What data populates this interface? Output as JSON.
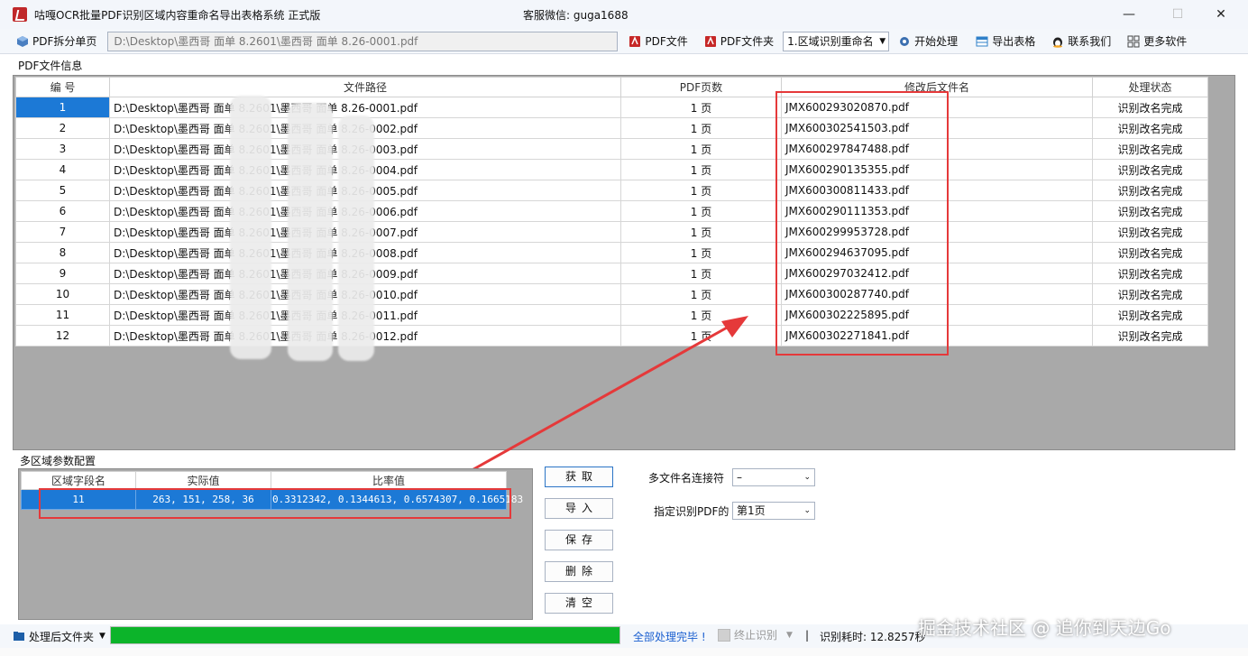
{
  "window": {
    "title": "咕嘎OCR批量PDF识别区域内容重命名导出表格系统    正式版",
    "service": "客服微信: guga1688",
    "minimize": "—",
    "maximize": "☐",
    "close": "✕"
  },
  "toolbar": {
    "split_label": "PDF拆分单页",
    "path_value": "D:\\Desktop\\墨西哥 面单 8.2601\\墨西哥 面单 8.26-0001.pdf",
    "pdf_file_label": "PDF文件",
    "pdf_folder_label": "PDF文件夹",
    "mode_value": "1.区域识别重命名",
    "start_label": "开始处理",
    "export_label": "导出表格",
    "contact_label": "联系我们",
    "more_label": "更多软件"
  },
  "pdf_group": {
    "label": "PDF文件信息",
    "columns": [
      "编 号",
      "文件路径",
      "PDF页数",
      "修改后文件名",
      "处理状态"
    ],
    "rows": [
      {
        "no": "1",
        "path": "D:\\Desktop\\墨西哥 面单 8.2601\\墨西哥 面单 8.26-0001.pdf",
        "pages": "1 页",
        "new_name": "JMX600293020870.pdf",
        "status": "识别改名完成"
      },
      {
        "no": "2",
        "path": "D:\\Desktop\\墨西哥 面单 8.2601\\墨西哥 面单 8.26-0002.pdf",
        "pages": "1 页",
        "new_name": "JMX600302541503.pdf",
        "status": "识别改名完成"
      },
      {
        "no": "3",
        "path": "D:\\Desktop\\墨西哥 面单 8.2601\\墨西哥 面单 8.26-0003.pdf",
        "pages": "1 页",
        "new_name": "JMX600297847488.pdf",
        "status": "识别改名完成"
      },
      {
        "no": "4",
        "path": "D:\\Desktop\\墨西哥 面单 8.2601\\墨西哥 面单 8.26-0004.pdf",
        "pages": "1 页",
        "new_name": "JMX600290135355.pdf",
        "status": "识别改名完成"
      },
      {
        "no": "5",
        "path": "D:\\Desktop\\墨西哥 面单 8.2601\\墨西哥 面单 8.26-0005.pdf",
        "pages": "1 页",
        "new_name": "JMX600300811433.pdf",
        "status": "识别改名完成"
      },
      {
        "no": "6",
        "path": "D:\\Desktop\\墨西哥 面单 8.2601\\墨西哥 面单 8.26-0006.pdf",
        "pages": "1 页",
        "new_name": "JMX600290111353.pdf",
        "status": "识别改名完成"
      },
      {
        "no": "7",
        "path": "D:\\Desktop\\墨西哥 面单 8.2601\\墨西哥 面单 8.26-0007.pdf",
        "pages": "1 页",
        "new_name": "JMX600299953728.pdf",
        "status": "识别改名完成"
      },
      {
        "no": "8",
        "path": "D:\\Desktop\\墨西哥 面单 8.2601\\墨西哥 面单 8.26-0008.pdf",
        "pages": "1 页",
        "new_name": "JMX600294637095.pdf",
        "status": "识别改名完成"
      },
      {
        "no": "9",
        "path": "D:\\Desktop\\墨西哥 面单 8.2601\\墨西哥 面单 8.26-0009.pdf",
        "pages": "1 页",
        "new_name": "JMX600297032412.pdf",
        "status": "识别改名完成"
      },
      {
        "no": "10",
        "path": "D:\\Desktop\\墨西哥 面单 8.2601\\墨西哥 面单 8.26-0010.pdf",
        "pages": "1 页",
        "new_name": "JMX600300287740.pdf",
        "status": "识别改名完成"
      },
      {
        "no": "11",
        "path": "D:\\Desktop\\墨西哥 面单 8.2601\\墨西哥 面单 8.26-0011.pdf",
        "pages": "1 页",
        "new_name": "JMX600302225895.pdf",
        "status": "识别改名完成"
      },
      {
        "no": "12",
        "path": "D:\\Desktop\\墨西哥 面单 8.2601\\墨西哥 面单 8.26-0012.pdf",
        "pages": "1 页",
        "new_name": "JMX600302271841.pdf",
        "status": "识别改名完成"
      }
    ]
  },
  "region_group": {
    "label": "多区域参数配置",
    "columns": [
      "区域字段名",
      "实际值",
      "比率值"
    ],
    "rows": [
      {
        "field": "11",
        "actual": "263, 151, 258, 36",
        "ratio": "0.3312342, 0.1344613, 0.6574307, 0.1665183"
      }
    ],
    "buttons": {
      "fetch": "获取",
      "import": "导入",
      "save": "保存",
      "delete": "删除",
      "clear": "清空"
    }
  },
  "options": {
    "connector_label": "多文件名连接符",
    "connector_value": "–",
    "page_label": "指定识别PDF的",
    "page_value": "第1页"
  },
  "status": {
    "folder_label": "处理后文件夹",
    "progress": 1.0,
    "done_text": "全部处理完毕 !",
    "stop_label": "终止识别",
    "separator": "|",
    "elapsed": "识别耗时: 12.8257秒"
  },
  "watermark": "掘金技术社区 @ 追你到天边Go",
  "colors": {
    "selection": "#1c79d6",
    "highlight_box": "#e5393a",
    "progress": "#0cb42a",
    "done_text": "#1a5fd0"
  }
}
